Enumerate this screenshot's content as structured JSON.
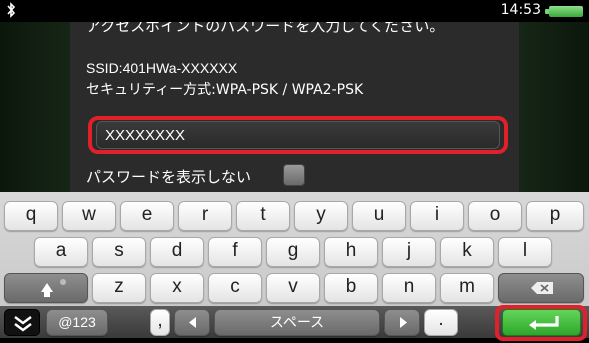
{
  "status": {
    "time": "14:53",
    "icons": [
      "bluetooth-icon",
      "battery-icon"
    ]
  },
  "dialog": {
    "prompt": "アクセスポイントのパスワードを入力してください。",
    "ssid": "SSID:401HWa-XXXXXX",
    "security": "セキュリティー方式:WPA-PSK / WPA2-PSK",
    "password_value": "XXXXXXXX",
    "show_password_label": "パスワードを表示しない"
  },
  "keyboard": {
    "row1": [
      "q",
      "w",
      "e",
      "r",
      "t",
      "y",
      "u",
      "i",
      "o",
      "p"
    ],
    "row2": [
      "a",
      "s",
      "d",
      "f",
      "g",
      "h",
      "j",
      "k",
      "l"
    ],
    "row3": [
      "z",
      "x",
      "c",
      "v",
      "b",
      "n",
      "m"
    ],
    "symbols_label": "@123",
    "comma": ",",
    "period": ".",
    "space_label": "スペース"
  },
  "colors": {
    "highlight": "#e0202a",
    "enter": "#3bb335",
    "battery": "#5cc85a"
  }
}
